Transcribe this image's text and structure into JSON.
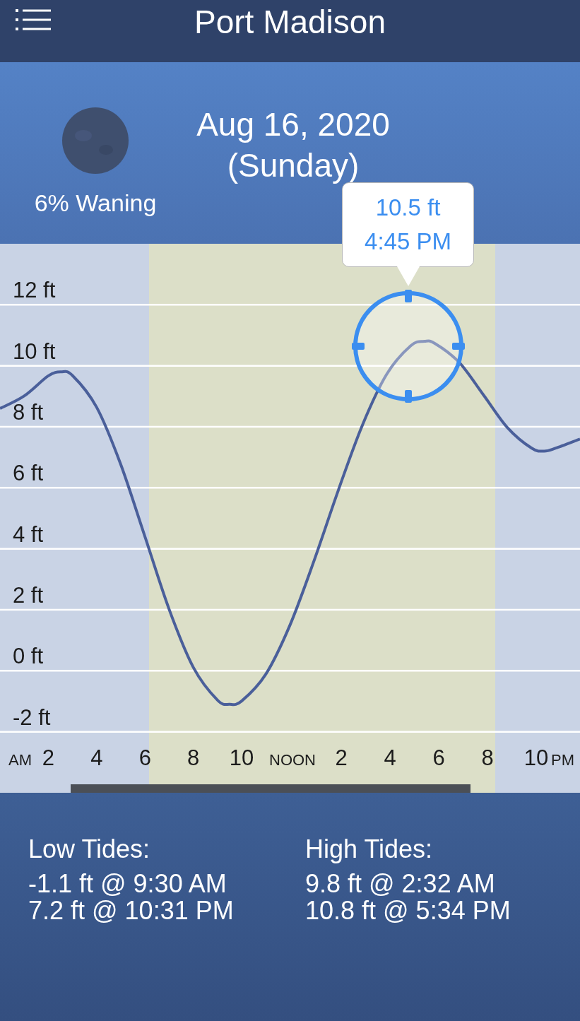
{
  "header": {
    "title": "Port Madison"
  },
  "day": {
    "moon_phase": "6% Waning",
    "date": "Aug 16, 2020",
    "weekday": "(Sunday)"
  },
  "tooltip": {
    "height": "10.5 ft",
    "time": "4:45 PM"
  },
  "chart": {
    "am_label": "AM",
    "pm_label": "PM",
    "afternoon_ticks": [
      "NOON",
      "2",
      "4",
      "6",
      "8",
      "10"
    ],
    "chart_data": {
      "type": "line",
      "x": [
        0,
        1,
        2,
        2.53,
        3,
        4,
        5,
        6,
        7,
        8,
        9,
        9.5,
        10,
        11,
        12,
        13,
        14,
        15,
        16,
        17,
        17.57,
        18,
        19,
        20,
        21,
        22,
        22.52,
        23,
        24
      ],
      "series": [
        {
          "color": "#4a5f9a",
          "values": [
            8.6,
            9.01,
            9.67,
            9.8,
            9.68,
            8.64,
            6.76,
            4.39,
            2.01,
            0.11,
            -0.96,
            -1.1,
            -0.99,
            -0.11,
            1.5,
            3.62,
            5.92,
            8.06,
            9.72,
            10.66,
            10.8,
            10.73,
            10.11,
            9.05,
            7.97,
            7.3,
            7.2,
            7.3,
            7.6
          ]
        }
      ],
      "xlim": [
        0,
        24
      ],
      "ylim": [
        -4,
        14
      ],
      "grid": true,
      "xticks": [
        {
          "value": 2,
          "label": "2"
        },
        {
          "value": 4,
          "label": "4"
        },
        {
          "value": 6,
          "label": "6"
        },
        {
          "value": 8,
          "label": "8"
        },
        {
          "value": 10,
          "label": "10"
        }
      ],
      "yticks": [
        {
          "value": 12,
          "label": "12 ft"
        },
        {
          "value": 10,
          "label": "10 ft"
        },
        {
          "value": 8,
          "label": "8 ft"
        },
        {
          "value": 6,
          "label": "6 ft"
        },
        {
          "value": 4,
          "label": "4 ft"
        },
        {
          "value": 2,
          "label": "2 ft"
        },
        {
          "value": 0,
          "label": "0 ft"
        },
        {
          "value": -2,
          "label": "-2 ft"
        }
      ]
    }
  },
  "low_tides": {
    "title": "Low Tides:",
    "items": [
      "-1.1 ft @ 9:30 AM",
      "7.2 ft @ 10:31 PM"
    ]
  },
  "high_tides": {
    "title": "High Tides:",
    "items": [
      "9.8 ft @ 2:32 AM",
      "10.8 ft @ 5:34 PM"
    ]
  }
}
